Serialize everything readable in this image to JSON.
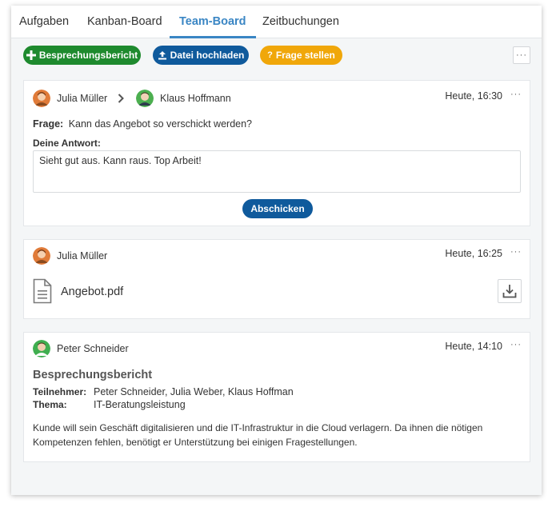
{
  "tabs": [
    {
      "label": "Aufgaben"
    },
    {
      "label": "Kanban-Board"
    },
    {
      "label": "Team-Board",
      "active": true
    },
    {
      "label": "Zeitbuchungen"
    }
  ],
  "toolbar": {
    "report_label": "Besprechungsbericht",
    "upload_label": "Datei hochladen",
    "question_label": "Frage stellen",
    "more_label": "···"
  },
  "colors": {
    "accent": "#3a86c4",
    "green": "#1e8a2e",
    "blue": "#0f5a9c",
    "orange": "#f0a70a"
  },
  "posts": {
    "question": {
      "from": "Julia Müller",
      "to": "Klaus Hoffmann",
      "time": "Heute, 16:30",
      "question_label": "Frage:",
      "question_text": "Kann das Angebot so verschickt werden?",
      "answer_label": "Deine Antwort:",
      "answer_value": "Sieht gut aus. Kann raus. Top Arbeit!",
      "submit_label": "Abschicken"
    },
    "file": {
      "author": "Julia Müller",
      "time": "Heute, 16:25",
      "file_name": "Angebot.pdf"
    },
    "report": {
      "author": "Peter Schneider",
      "time": "Heute, 14:10",
      "title": "Besprechungsbericht",
      "participants_label": "Teilnehmer:",
      "participants": "Peter Schneider, Julia Weber, Klaus Hoffman",
      "topic_label": "Thema:",
      "topic": "IT-Beratungsleistung",
      "body_line1": "Kunde will sein Geschäft digitalisieren und die IT-Infrastruktur in die Cloud verlagern. Da ihnen die nötigen",
      "body_line2": "Kompetenzen fehlen, benötigt er Unterstützung bei einigen Fragestellungen."
    }
  },
  "more_dots": "···"
}
